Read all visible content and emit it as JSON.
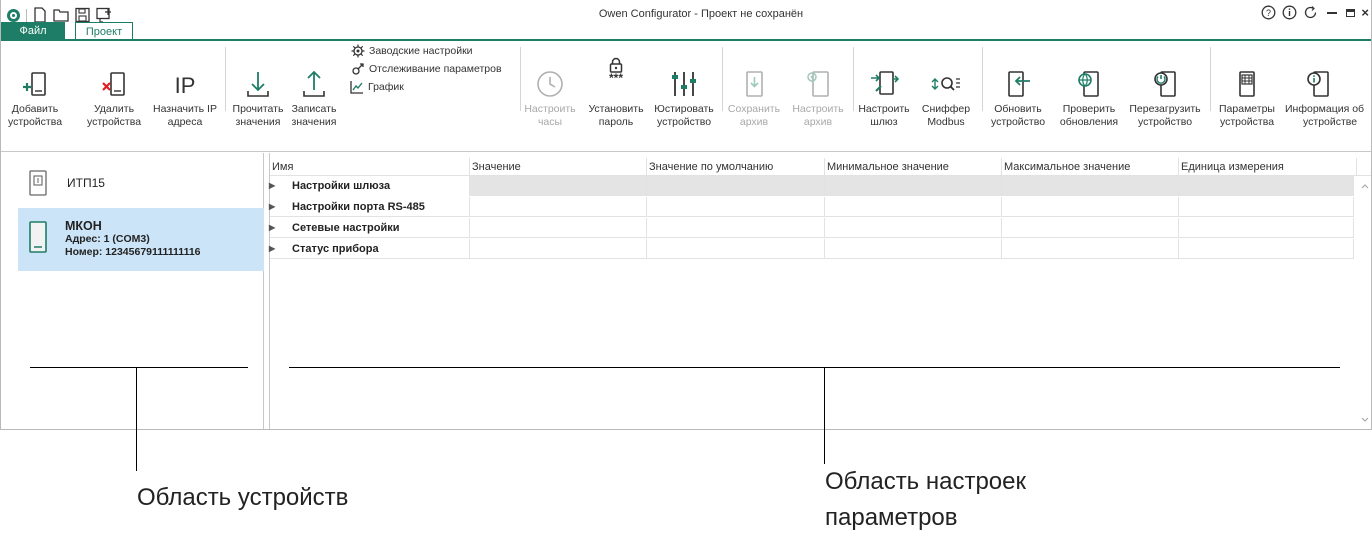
{
  "window": {
    "title": "Owen Configurator - Проект не сохранён",
    "tabs": {
      "file": "Файл",
      "project": "Проект"
    }
  },
  "ribbon": {
    "add_device": [
      "Добавить",
      "устройства"
    ],
    "remove_device": [
      "Удалить",
      "устройства"
    ],
    "assign_ip": [
      "Назначить IP",
      "адреса"
    ],
    "read_values": [
      "Прочитать",
      "значения"
    ],
    "write_values": [
      "Записать",
      "значения"
    ],
    "factory_settings": "Заводские настройки",
    "param_tracking": "Отслеживание параметров",
    "graph": "График",
    "set_clock": [
      "Настроить",
      "часы"
    ],
    "set_password": [
      "Установить",
      "пароль"
    ],
    "adjust_device": [
      "Юстировать",
      "устройство"
    ],
    "save_archive": [
      "Сохранить",
      "архив"
    ],
    "config_archive": [
      "Настроить",
      "архив"
    ],
    "config_gateway": [
      "Настроить",
      "шлюз"
    ],
    "modbus_sniffer": [
      "Сниффер",
      "Modbus"
    ],
    "update_device": [
      "Обновить",
      "устройство"
    ],
    "check_updates": [
      "Проверить",
      "обновления"
    ],
    "reboot_device": [
      "Перезагрузить",
      "устройство"
    ],
    "device_params": [
      "Параметры",
      "устройства"
    ],
    "device_info": [
      "Информация об",
      "устройстве"
    ],
    "ip_icon_text": "IP",
    "password_icon_text": "***"
  },
  "devices": [
    {
      "name": "ИТП15"
    },
    {
      "name": "МКОН",
      "address": "Адрес: 1 (COM3)",
      "number": "Номер: 12345679111111116"
    }
  ],
  "grid": {
    "columns": [
      "Имя",
      "Значение",
      "Значение по умолчанию",
      "Минимальное значение",
      "Максимальное значение",
      "Единица измерения"
    ],
    "rows": [
      "Настройки шлюза",
      "Настройки порта RS-485",
      "Сетевые настройки",
      "Статус прибора"
    ]
  },
  "annotations": {
    "devices_area": "Область устройств",
    "params_area_1": "Область настроек",
    "params_area_2": "параметров"
  },
  "colors": {
    "accent": "#1e7d66",
    "selection": "#cce4f7",
    "icon_red": "#e02020"
  }
}
